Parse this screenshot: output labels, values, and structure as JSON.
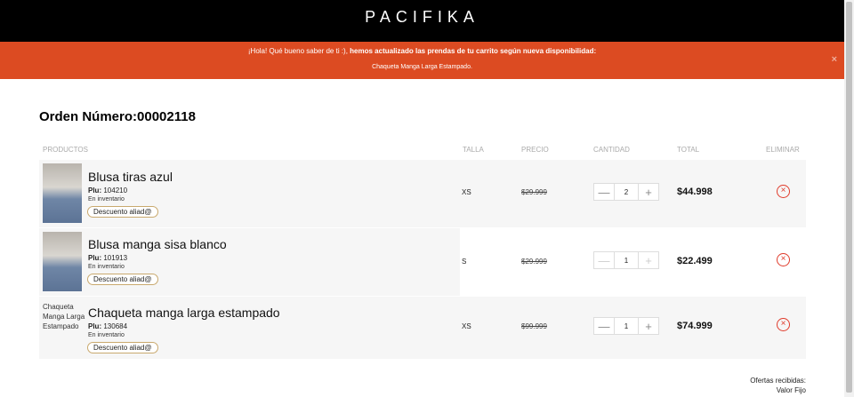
{
  "header": {
    "logo": "PACIFIKA"
  },
  "banner": {
    "message_plain": "¡Hola! Qué bueno saber de ti :), ",
    "message_bold": "hemos actualizado las prendas de tu carrito según nueva disponibilidad:",
    "item": "Chaqueta Manga Larga Estampado.",
    "close_label": "×"
  },
  "order": {
    "label": "Orden Número:",
    "number": "00002118"
  },
  "columns": {
    "productos": "PRODUCTOS",
    "talla": "TALLA",
    "precio": "PRECIO",
    "cantidad": "CANTIDAD",
    "total": "TOTAL",
    "eliminar": "ELIMINAR"
  },
  "items": [
    {
      "name": "Blusa tiras azul",
      "plu_label": "Plu:",
      "plu": "104210",
      "stock": "En inventario",
      "discount": "Descuento aliad@",
      "size": "XS",
      "price": "$29.999",
      "qty": "2",
      "total": "$44.998"
    },
    {
      "name": "Blusa manga sisa blanco",
      "plu_label": "Plu:",
      "plu": "101913",
      "stock": "En inventario",
      "discount": "Descuento aliad@",
      "size": "S",
      "price": "$29.999",
      "qty": "1",
      "total": "$22.499"
    },
    {
      "name": "Chaqueta manga larga estampado",
      "image_alt": "Chaqueta Manga Larga Estampado",
      "plu_label": "Plu:",
      "plu": "130684",
      "stock": "En inventario",
      "discount": "Descuento aliad@",
      "size": "XS",
      "price": "$99.999",
      "qty": "1",
      "total": "$74.999"
    }
  ],
  "qty_controls": {
    "minus": "—",
    "plus": "+"
  },
  "delete_glyph": "×",
  "offers": {
    "label": "Ofertas recibidas:",
    "value": "Valor Fijo"
  },
  "colors": {
    "banner": "#dc4b22",
    "topbar": "#000000",
    "delete": "#e03b2b",
    "discount_border": "#c9a96e"
  }
}
